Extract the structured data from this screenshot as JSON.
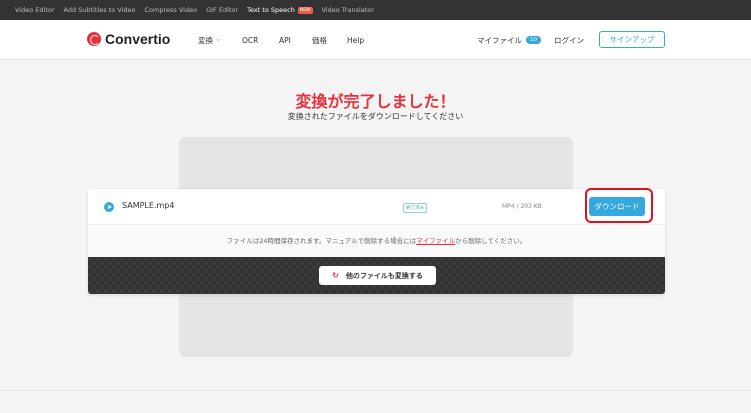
{
  "topbar": {
    "links": [
      "Video Editor",
      "Add Subtitles to Video",
      "Compress Video",
      "GIF Editor",
      "Text to Speech",
      "Video Translator"
    ],
    "new_badge": "NEW"
  },
  "header": {
    "logo_text": "Convertio",
    "nav": {
      "convert": "変換",
      "ocr": "OCR",
      "api": "API",
      "pricing": "価格",
      "help": "Help"
    },
    "my_files": "マイファイル",
    "my_files_count": "10",
    "login": "ログイン",
    "signup": "サインアップ"
  },
  "main": {
    "title": "変換が完了しました！",
    "subtitle": "変換されたファイルをダウンロードしてください"
  },
  "file": {
    "name": "SAMPLE.mp4",
    "status": "終了済み",
    "meta": "MP4 / 203 KB",
    "download_label": "ダウンロード"
  },
  "note": {
    "before": "ファイルは24時間保存されます。マニュアルで削除する場合には",
    "link": "マイファイル",
    "after": "から削除してください。"
  },
  "convert_more_label": "他のファイルも変換する",
  "colors": {
    "accent_red": "#e8303a",
    "accent_blue": "#35a8e0",
    "highlight": "#e4101c"
  },
  "icons": [
    "logo-icon",
    "chevron-down-icon",
    "play-icon",
    "refresh-icon"
  ]
}
